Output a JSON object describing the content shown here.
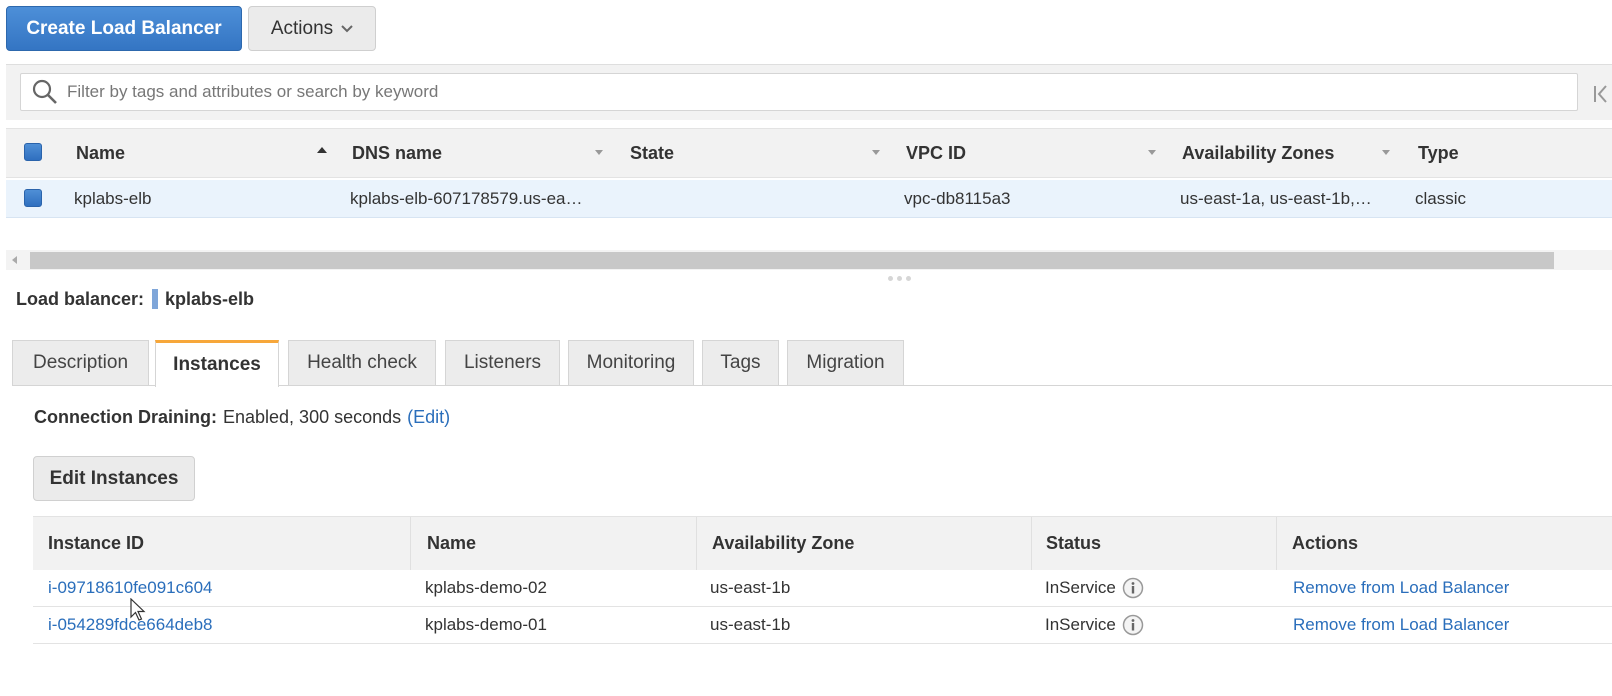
{
  "toolbar": {
    "create_label": "Create Load Balancer",
    "actions_label": "Actions"
  },
  "filter": {
    "placeholder": "Filter by tags and attributes or search by keyword"
  },
  "lb_table": {
    "columns": [
      "Name",
      "DNS name",
      "State",
      "VPC ID",
      "Availability Zones",
      "Type"
    ],
    "rows": [
      {
        "name": "kplabs-elb",
        "dns": "kplabs-elb-607178579.us-ea…",
        "state": "",
        "vpc": "vpc-db8115a3",
        "zones": "us-east-1a, us-east-1b,…",
        "type": "classic"
      }
    ]
  },
  "details": {
    "label_key": "Load balancer:",
    "label_value": "kplabs-elb",
    "tabs": [
      "Description",
      "Instances",
      "Health check",
      "Listeners",
      "Monitoring",
      "Tags",
      "Migration"
    ],
    "active_tab": "Instances",
    "draining": {
      "key": "Connection Draining:",
      "value": "Enabled, 300 seconds",
      "edit": "(Edit)"
    },
    "edit_instances_label": "Edit Instances"
  },
  "instances": {
    "columns": [
      "Instance ID",
      "Name",
      "Availability Zone",
      "Status",
      "Actions"
    ],
    "rows": [
      {
        "id": "i-09718610fe091c604",
        "name": "kplabs-demo-02",
        "zone": "us-east-1b",
        "status": "InService",
        "action": "Remove from Load Balancer"
      },
      {
        "id": "i-054289fdce664deb8",
        "name": "kplabs-demo-01",
        "zone": "us-east-1b",
        "status": "InService",
        "action": "Remove from Load Balancer"
      }
    ]
  },
  "colors": {
    "primary": "#3475c3",
    "link": "#2a6ebb",
    "active_tab_accent": "#f7a73a",
    "selected_row": "#eaf3fc"
  }
}
